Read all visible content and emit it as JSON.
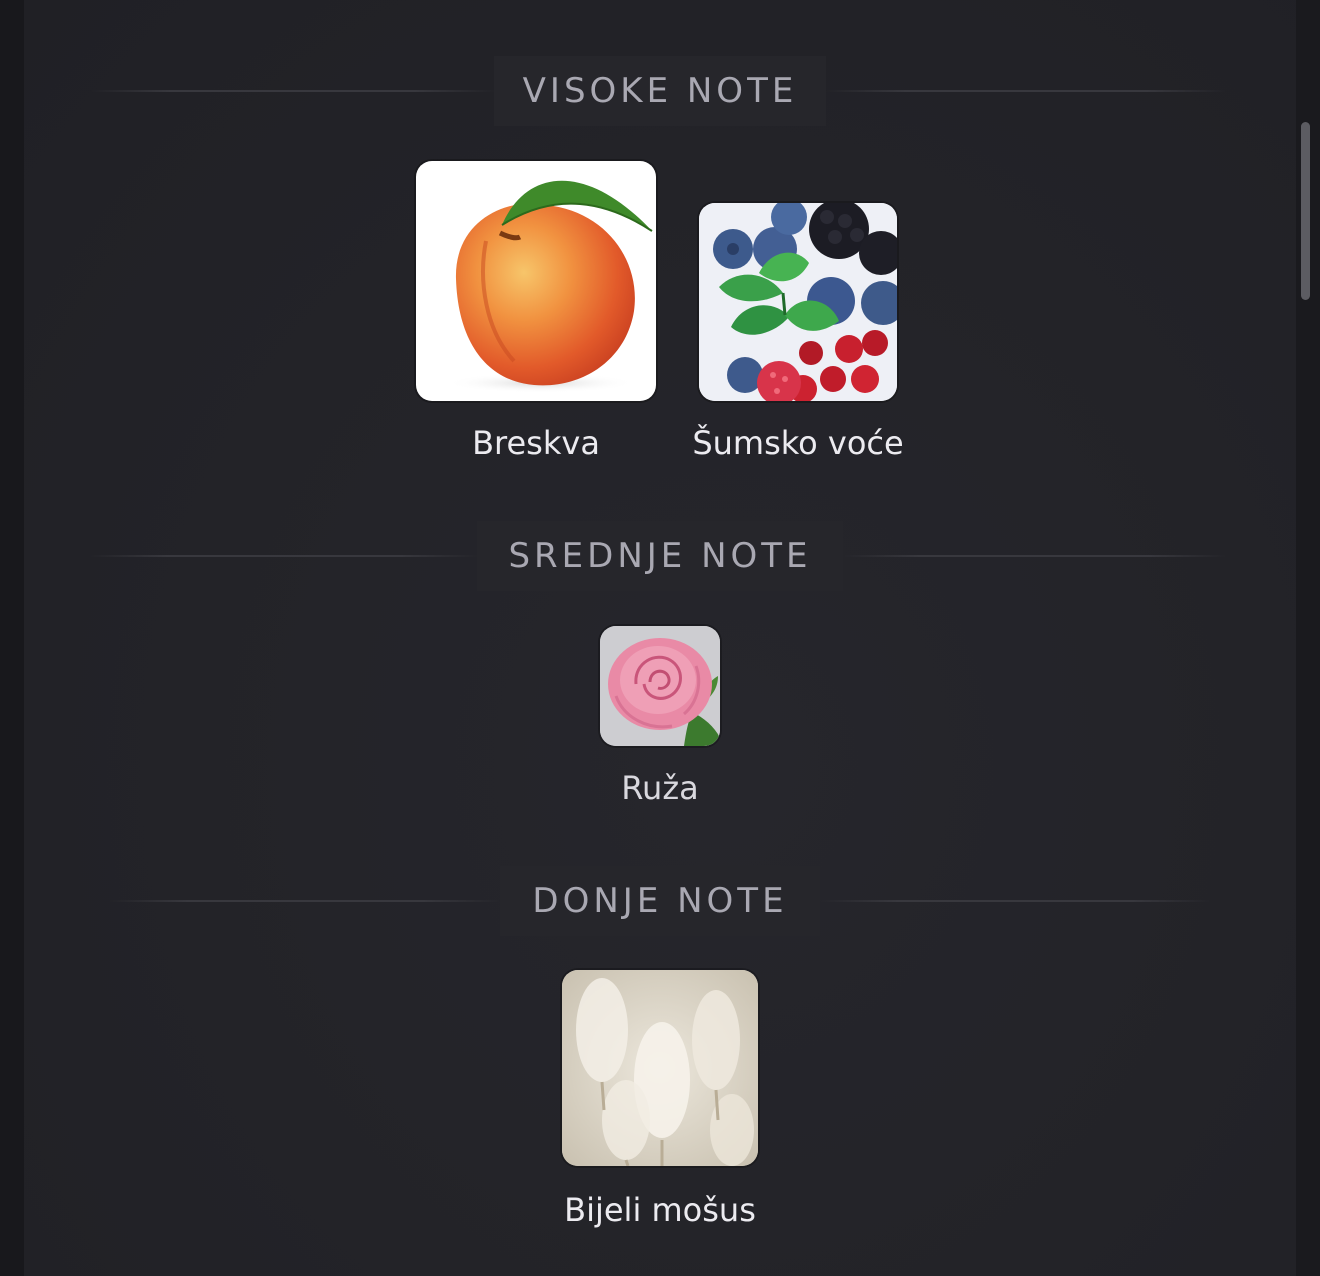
{
  "sections": [
    {
      "title": "VISOKE NOTE",
      "notes": [
        {
          "label": "Breskva",
          "icon": "peach-icon"
        },
        {
          "label": "Šumsko voće",
          "icon": "forest-fruit-icon"
        }
      ]
    },
    {
      "title": "SREDNJE NOTE",
      "notes": [
        {
          "label": "Ruža",
          "icon": "rose-icon"
        }
      ]
    },
    {
      "title": "DONJE NOTE",
      "notes": [
        {
          "label": "Bijeli mošus",
          "icon": "white-musk-icon"
        }
      ]
    }
  ],
  "colors": {
    "background": "#232328",
    "header_text": "#a9a8b2",
    "label_text": "#ecebf0"
  }
}
